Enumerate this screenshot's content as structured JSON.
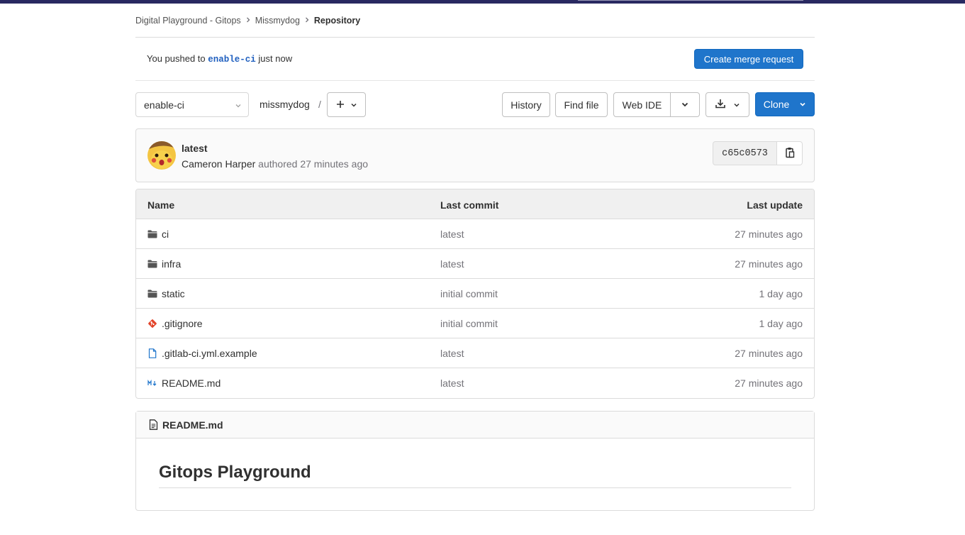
{
  "breadcrumb": {
    "items": [
      "Digital Playground - Gitops",
      "Missmydog"
    ],
    "current": "Repository"
  },
  "push_banner": {
    "prefix": "You pushed to ",
    "branch": "enable-ci",
    "suffix": " just now",
    "button": "Create merge request"
  },
  "toolbar": {
    "branch": "enable-ci",
    "path": "missmydog",
    "path_sep": "/",
    "history": "History",
    "find_file": "Find file",
    "web_ide": "Web IDE",
    "clone": "Clone"
  },
  "commit": {
    "title": "latest",
    "author": "Cameron Harper",
    "meta": " authored 27 minutes ago",
    "sha": "c65c0573"
  },
  "table": {
    "headers": {
      "name": "Name",
      "last_commit": "Last commit",
      "last_update": "Last update"
    },
    "rows": [
      {
        "name": "ci",
        "icon": "folder-icon",
        "commit": "latest",
        "updated": "27 minutes ago"
      },
      {
        "name": "infra",
        "icon": "folder-icon",
        "commit": "latest",
        "updated": "27 minutes ago"
      },
      {
        "name": "static",
        "icon": "folder-icon",
        "commit": "initial commit",
        "updated": "1 day ago"
      },
      {
        "name": ".gitignore",
        "icon": "git-icon",
        "commit": "initial commit",
        "updated": "1 day ago"
      },
      {
        "name": ".gitlab-ci.yml.example",
        "icon": "file-icon",
        "commit": "latest",
        "updated": "27 minutes ago"
      },
      {
        "name": "README.md",
        "icon": "markdown-icon",
        "commit": "latest",
        "updated": "27 minutes ago"
      }
    ]
  },
  "readme": {
    "filename": "README.md",
    "heading": "Gitops Playground"
  },
  "colors": {
    "primary": "#1f75cb",
    "topbar": "#292961",
    "git_icon": "#e24329",
    "file_icon": "#1f75cb"
  }
}
